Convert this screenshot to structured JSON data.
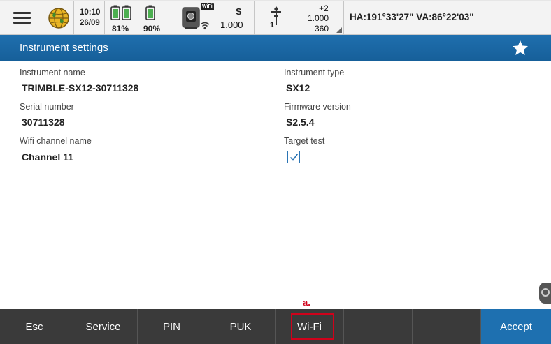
{
  "statusbar": {
    "time": "10:10",
    "date": "26/09",
    "battery_left": "81%",
    "battery_right": "90%",
    "wifi_badge": "WiFi",
    "instrument_letter": "S",
    "instrument_value": "1.000",
    "target_count": "1",
    "target_prism_constant": "+2",
    "target_height": "1.000",
    "target_value": "360",
    "angles": "HA:191°33'27\"  VA:86°22'03\""
  },
  "title": "Instrument settings",
  "fields": {
    "instrument_name_label": "Instrument name",
    "instrument_name_value": "TRIMBLE-SX12-30711328",
    "serial_number_label": "Serial number",
    "serial_number_value": "30711328",
    "wifi_channel_label": "Wifi channel name",
    "wifi_channel_value": "Channel 11",
    "instrument_type_label": "Instrument type",
    "instrument_type_value": "SX12",
    "firmware_label": "Firmware version",
    "firmware_value": "S2.5.4",
    "target_test_label": "Target test",
    "target_test_checked": true
  },
  "annotation": "a.",
  "buttons": {
    "esc": "Esc",
    "service": "Service",
    "pin": "PIN",
    "puk": "PUK",
    "wifi": "Wi-Fi",
    "accept": "Accept"
  },
  "icons": [
    "menu-icon",
    "globe-icon",
    "battery-icon",
    "total-station-icon",
    "wifi-icon",
    "prism-pole-icon",
    "star-icon",
    "checkmark-icon"
  ],
  "colors": {
    "title_bar": "#1e6fae",
    "accept_button": "#1e70b0",
    "bottom_bar": "#3a3a3a",
    "highlight": "#d0021b",
    "battery_fill": "#4caf50"
  }
}
